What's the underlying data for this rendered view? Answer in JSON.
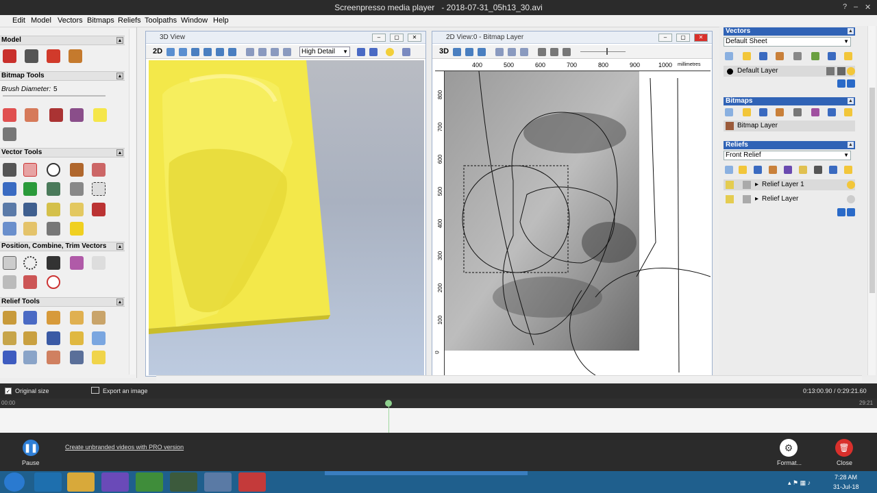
{
  "player": {
    "title": "Screenpresso media player",
    "file": "- 2018-07-31_05h13_30.avi",
    "ctrl_help": "?",
    "ctrl_min": "–",
    "ctrl_max": "▢",
    "ctrl_close": "✕"
  },
  "menu": [
    "Edit",
    "Model",
    "Vectors",
    "Bitmaps",
    "Reliefs",
    "Toolpaths",
    "Window",
    "Help"
  ],
  "left_panel": {
    "sections": [
      "Model",
      "Bitmap Tools",
      "Vector Tools",
      "Position, Combine, Trim Vectors",
      "Relief Tools"
    ],
    "brush_label": "Brush Diameter:",
    "brush_value": "5"
  },
  "view3d": {
    "title": "3D View",
    "mode": "2D",
    "detail": "High Detail"
  },
  "view2d": {
    "title": "2D View:0 - Bitmap Layer",
    "mode": "3D",
    "units": "millimetres",
    "hruler": [
      "400",
      "500",
      "600",
      "700",
      "800",
      "900",
      "1000"
    ],
    "vruler": [
      "800",
      "700",
      "600",
      "500",
      "400",
      "300",
      "200",
      "100",
      "0"
    ]
  },
  "right_panel": {
    "vectors_title": "Vectors",
    "vectors_sheet": "Default Sheet",
    "default_layer": "Default Layer",
    "bitmaps_title": "Bitmaps",
    "bitmap_layer": "Bitmap Layer",
    "reliefs_title": "Reliefs",
    "relief_select": "Front Relief",
    "relief_layer_1": "Relief Layer 1",
    "relief_layer": "Relief Layer"
  },
  "status": {
    "original_size": "Original size",
    "export_image": "Export an image",
    "time": "0:13:00.90 / 0:29:21.60",
    "tl_start": "00:00",
    "tl_end": "29:21"
  },
  "controls": {
    "pause": "Pause",
    "promo": "Create unbranded videos with PRO version",
    "format": "Format...",
    "close": "Close"
  },
  "taskbar": {
    "time": "7:28 AM",
    "date": "31-Jul-18"
  },
  "colors": {
    "accent_blue": "#3063b6",
    "relief_yellow": "#f3e84a",
    "close_red": "#d9302c",
    "pause_blue": "#2f7fd6"
  }
}
